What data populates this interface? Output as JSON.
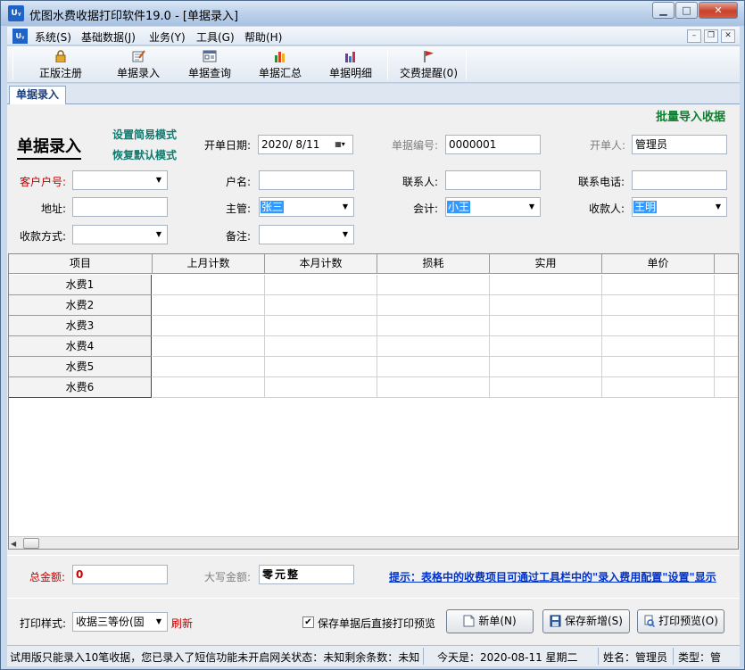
{
  "window": {
    "logo": "Uᵧ",
    "title": "优图水费收据打印软件19.0 - [单据录入]",
    "caption_buttons": {
      "minimize": "▁",
      "maximize": "□",
      "close": "✕"
    }
  },
  "menubar": {
    "logo": "Uᵧ",
    "items": [
      "系统(S)",
      "基础数据(J)",
      "业务(Y)",
      "工具(G)",
      "帮助(H)"
    ],
    "mdi_buttons": [
      "–",
      "❐",
      "✕"
    ]
  },
  "toolbar": {
    "buttons": [
      {
        "label": "正版注册",
        "icon": "lock-icon"
      },
      {
        "label": "单据录入",
        "icon": "edit-receipt-icon"
      },
      {
        "label": "单据查询",
        "icon": "search-window-icon"
      },
      {
        "label": "单据汇总",
        "icon": "bar-chart-icon"
      },
      {
        "label": "单据明细",
        "icon": "bar-chart-detail-icon"
      },
      {
        "label": "交费提醒(0)",
        "icon": "flag-icon"
      }
    ]
  },
  "tab": {
    "label": "单据录入"
  },
  "form": {
    "batch_import": "批量导入收据",
    "heading": "单据录入",
    "mode_simple": "设置简易模式",
    "mode_default": "恢复默认模式",
    "date_label": "开单日期:",
    "date_value": "2020/  8/11",
    "receipt_no_label": "单据编号:",
    "receipt_no_value": "0000001",
    "issuer_label": "开单人:",
    "issuer_value": "管理员",
    "customer_no_label": "客户户号:",
    "customer_no_value": "",
    "name_label": "户名:",
    "name_value": "",
    "contact_label": "联系人:",
    "contact_value": "",
    "phone_label": "联系电话:",
    "phone_value": "",
    "address_label": "地址:",
    "address_value": "",
    "supervisor_label": "主管:",
    "supervisor_value": "张三",
    "accountant_label": "会计:",
    "accountant_value": "小王",
    "payee_label": "收款人:",
    "payee_value": "王明",
    "pay_method_label": "收款方式:",
    "pay_method_value": "",
    "remark_label": "备注:",
    "remark_value": ""
  },
  "grid": {
    "columns": [
      "项目",
      "上月计数",
      "本月计数",
      "损耗",
      "实用",
      "单价"
    ],
    "rows": [
      "水费1",
      "水费2",
      "水费3",
      "水费4",
      "水费5",
      "水费6"
    ]
  },
  "totals": {
    "total_label": "总金额:",
    "total_value": "0",
    "caps_label": "大写金额:",
    "caps_value": "零元整",
    "hint": "提示：表格中的收费项目可通过工具栏中的\"录入费用配置\"设置\"显示"
  },
  "bottom": {
    "print_style_label": "打印样式:",
    "print_style_value": "收据三等份(固",
    "refresh": "刷新",
    "preview_checkbox_label": "保存单据后直接打印预览",
    "preview_checked": true,
    "new_button": "新单(N)",
    "save_new_button": "保存新增(S)",
    "print_preview_button": "打印预览(O)"
  },
  "statusbar": {
    "trial_notice": "试用版只能录入10笔收据，您已录入了短信功能未开启网关状态：未知剩余条数：未知",
    "today": "今天是：2020-08-11 星期二",
    "user": "姓名：管理员",
    "type": "类型：管"
  },
  "colors": {
    "label_red": "#c00000",
    "teal_link": "#0f7a6e",
    "green_link": "#0b7f2d",
    "hint_blue": "#0033cc",
    "selection": "#3399ff"
  }
}
